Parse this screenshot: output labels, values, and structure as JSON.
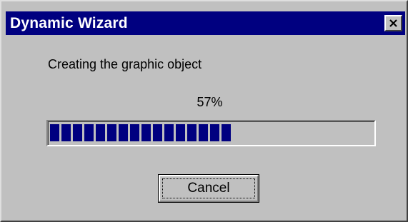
{
  "window": {
    "title": "Dynamic Wizard",
    "close_icon": "close-icon"
  },
  "dialog": {
    "message": "Creating the graphic object",
    "percent_label": "57%",
    "progress_fraction": 0.57,
    "cancel_label": "Cancel"
  },
  "colors": {
    "titlebar": "#000080",
    "progress_fill": "#000080",
    "face": "#c0c0c0"
  }
}
